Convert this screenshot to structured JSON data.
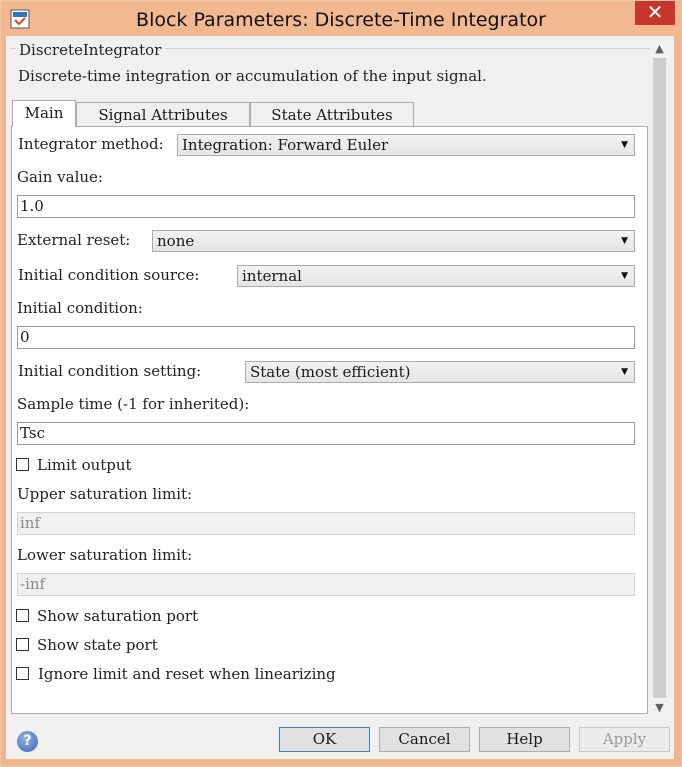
{
  "window": {
    "title": "Block Parameters: Discrete-Time Integrator",
    "close_glyph": "✕"
  },
  "description": {
    "group_title": "DiscreteIntegrator",
    "text": "Discrete-time integration or accumulation of the input signal."
  },
  "tabs": [
    {
      "label": "Main",
      "active": true
    },
    {
      "label": "Signal Attributes",
      "active": false
    },
    {
      "label": "State Attributes",
      "active": false
    }
  ],
  "main": {
    "integrator_method": {
      "label": "Integrator method:",
      "value": "Integration: Forward Euler"
    },
    "gain_value": {
      "label": "Gain value:",
      "value": "1.0"
    },
    "external_reset": {
      "label": "External reset:",
      "value": "none"
    },
    "initial_condition_source": {
      "label": "Initial condition source:",
      "value": "internal"
    },
    "initial_condition": {
      "label": "Initial condition:",
      "value": "0"
    },
    "initial_condition_setting": {
      "label": "Initial condition setting:",
      "value": "State (most efficient)"
    },
    "sample_time": {
      "label": "Sample time (-1 for inherited):",
      "value": "Tsc"
    },
    "limit_output": {
      "label": "Limit output",
      "checked": false
    },
    "upper_saturation": {
      "label": "Upper saturation limit:",
      "value": "inf"
    },
    "lower_saturation": {
      "label": "Lower saturation limit:",
      "value": "-inf"
    },
    "show_saturation_port": {
      "label": "Show saturation port",
      "checked": false
    },
    "show_state_port": {
      "label": "Show state port",
      "checked": false
    },
    "ignore_limit": {
      "label": "Ignore limit and reset when linearizing",
      "checked": false
    }
  },
  "buttons": {
    "help_glyph": "?",
    "ok": "OK",
    "cancel": "Cancel",
    "help": "Help",
    "apply": "Apply"
  },
  "icons": {
    "app": "simulink-block-icon",
    "help": "help-icon",
    "close": "close-icon"
  },
  "colors": {
    "titlebar": "#f2b890",
    "close": "#c7352b",
    "default_button_border": "#3c7fb1"
  }
}
